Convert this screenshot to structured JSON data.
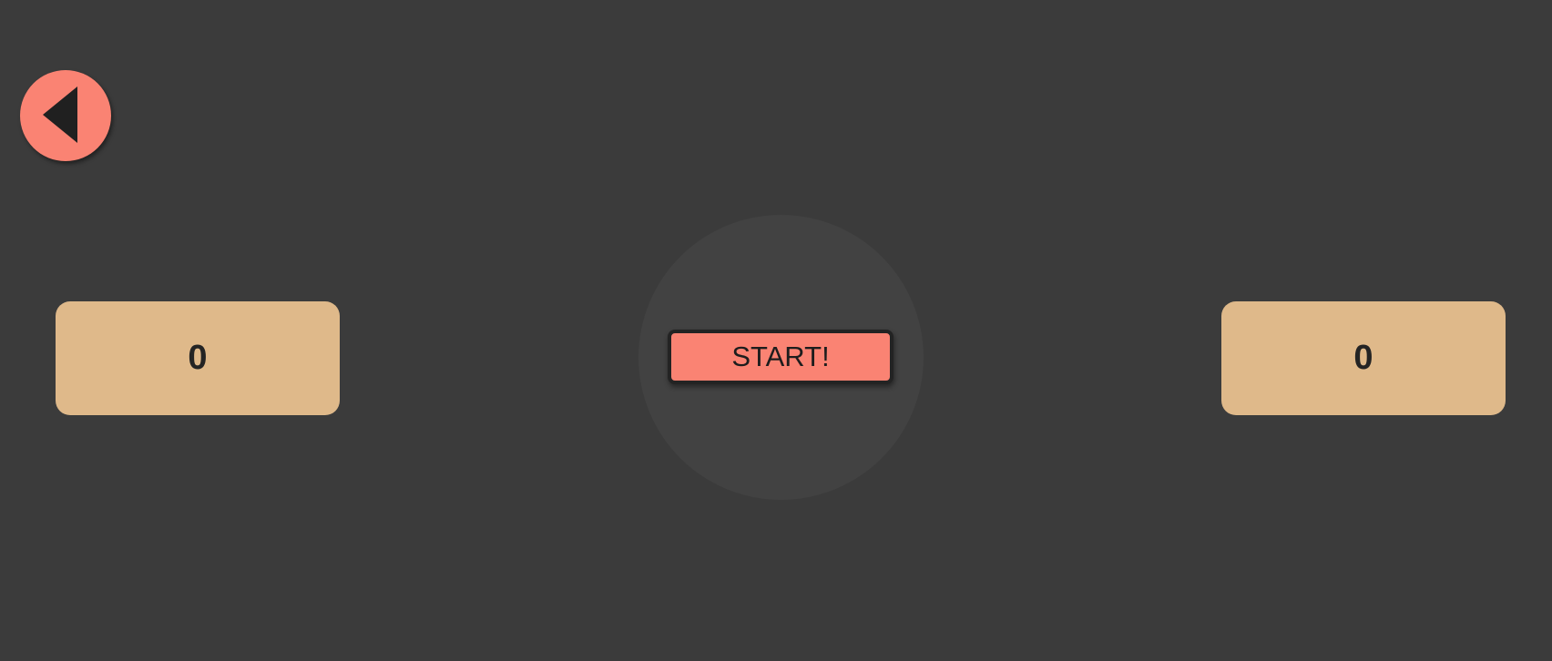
{
  "back_button": {
    "icon": "back-arrow-icon",
    "color": "#fa8373"
  },
  "start_button": {
    "label": "START!",
    "color": "#fa8373"
  },
  "scores": {
    "left": "0",
    "right": "0",
    "box_color": "#dfb98a"
  },
  "colors": {
    "background": "#3b3b3b",
    "center_circle": "#424242"
  }
}
